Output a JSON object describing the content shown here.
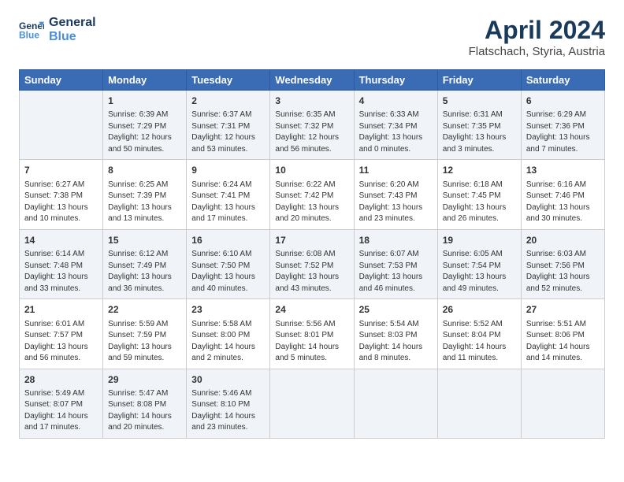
{
  "header": {
    "logo_line1": "General",
    "logo_line2": "Blue",
    "month_title": "April 2024",
    "subtitle": "Flatschach, Styria, Austria"
  },
  "weekdays": [
    "Sunday",
    "Monday",
    "Tuesday",
    "Wednesday",
    "Thursday",
    "Friday",
    "Saturday"
  ],
  "weeks": [
    [
      {
        "day": "",
        "content": ""
      },
      {
        "day": "1",
        "content": "Sunrise: 6:39 AM\nSunset: 7:29 PM\nDaylight: 12 hours\nand 50 minutes."
      },
      {
        "day": "2",
        "content": "Sunrise: 6:37 AM\nSunset: 7:31 PM\nDaylight: 12 hours\nand 53 minutes."
      },
      {
        "day": "3",
        "content": "Sunrise: 6:35 AM\nSunset: 7:32 PM\nDaylight: 12 hours\nand 56 minutes."
      },
      {
        "day": "4",
        "content": "Sunrise: 6:33 AM\nSunset: 7:34 PM\nDaylight: 13 hours\nand 0 minutes."
      },
      {
        "day": "5",
        "content": "Sunrise: 6:31 AM\nSunset: 7:35 PM\nDaylight: 13 hours\nand 3 minutes."
      },
      {
        "day": "6",
        "content": "Sunrise: 6:29 AM\nSunset: 7:36 PM\nDaylight: 13 hours\nand 7 minutes."
      }
    ],
    [
      {
        "day": "7",
        "content": "Sunrise: 6:27 AM\nSunset: 7:38 PM\nDaylight: 13 hours\nand 10 minutes."
      },
      {
        "day": "8",
        "content": "Sunrise: 6:25 AM\nSunset: 7:39 PM\nDaylight: 13 hours\nand 13 minutes."
      },
      {
        "day": "9",
        "content": "Sunrise: 6:24 AM\nSunset: 7:41 PM\nDaylight: 13 hours\nand 17 minutes."
      },
      {
        "day": "10",
        "content": "Sunrise: 6:22 AM\nSunset: 7:42 PM\nDaylight: 13 hours\nand 20 minutes."
      },
      {
        "day": "11",
        "content": "Sunrise: 6:20 AM\nSunset: 7:43 PM\nDaylight: 13 hours\nand 23 minutes."
      },
      {
        "day": "12",
        "content": "Sunrise: 6:18 AM\nSunset: 7:45 PM\nDaylight: 13 hours\nand 26 minutes."
      },
      {
        "day": "13",
        "content": "Sunrise: 6:16 AM\nSunset: 7:46 PM\nDaylight: 13 hours\nand 30 minutes."
      }
    ],
    [
      {
        "day": "14",
        "content": "Sunrise: 6:14 AM\nSunset: 7:48 PM\nDaylight: 13 hours\nand 33 minutes."
      },
      {
        "day": "15",
        "content": "Sunrise: 6:12 AM\nSunset: 7:49 PM\nDaylight: 13 hours\nand 36 minutes."
      },
      {
        "day": "16",
        "content": "Sunrise: 6:10 AM\nSunset: 7:50 PM\nDaylight: 13 hours\nand 40 minutes."
      },
      {
        "day": "17",
        "content": "Sunrise: 6:08 AM\nSunset: 7:52 PM\nDaylight: 13 hours\nand 43 minutes."
      },
      {
        "day": "18",
        "content": "Sunrise: 6:07 AM\nSunset: 7:53 PM\nDaylight: 13 hours\nand 46 minutes."
      },
      {
        "day": "19",
        "content": "Sunrise: 6:05 AM\nSunset: 7:54 PM\nDaylight: 13 hours\nand 49 minutes."
      },
      {
        "day": "20",
        "content": "Sunrise: 6:03 AM\nSunset: 7:56 PM\nDaylight: 13 hours\nand 52 minutes."
      }
    ],
    [
      {
        "day": "21",
        "content": "Sunrise: 6:01 AM\nSunset: 7:57 PM\nDaylight: 13 hours\nand 56 minutes."
      },
      {
        "day": "22",
        "content": "Sunrise: 5:59 AM\nSunset: 7:59 PM\nDaylight: 13 hours\nand 59 minutes."
      },
      {
        "day": "23",
        "content": "Sunrise: 5:58 AM\nSunset: 8:00 PM\nDaylight: 14 hours\nand 2 minutes."
      },
      {
        "day": "24",
        "content": "Sunrise: 5:56 AM\nSunset: 8:01 PM\nDaylight: 14 hours\nand 5 minutes."
      },
      {
        "day": "25",
        "content": "Sunrise: 5:54 AM\nSunset: 8:03 PM\nDaylight: 14 hours\nand 8 minutes."
      },
      {
        "day": "26",
        "content": "Sunrise: 5:52 AM\nSunset: 8:04 PM\nDaylight: 14 hours\nand 11 minutes."
      },
      {
        "day": "27",
        "content": "Sunrise: 5:51 AM\nSunset: 8:06 PM\nDaylight: 14 hours\nand 14 minutes."
      }
    ],
    [
      {
        "day": "28",
        "content": "Sunrise: 5:49 AM\nSunset: 8:07 PM\nDaylight: 14 hours\nand 17 minutes."
      },
      {
        "day": "29",
        "content": "Sunrise: 5:47 AM\nSunset: 8:08 PM\nDaylight: 14 hours\nand 20 minutes."
      },
      {
        "day": "30",
        "content": "Sunrise: 5:46 AM\nSunset: 8:10 PM\nDaylight: 14 hours\nand 23 minutes."
      },
      {
        "day": "",
        "content": ""
      },
      {
        "day": "",
        "content": ""
      },
      {
        "day": "",
        "content": ""
      },
      {
        "day": "",
        "content": ""
      }
    ]
  ]
}
